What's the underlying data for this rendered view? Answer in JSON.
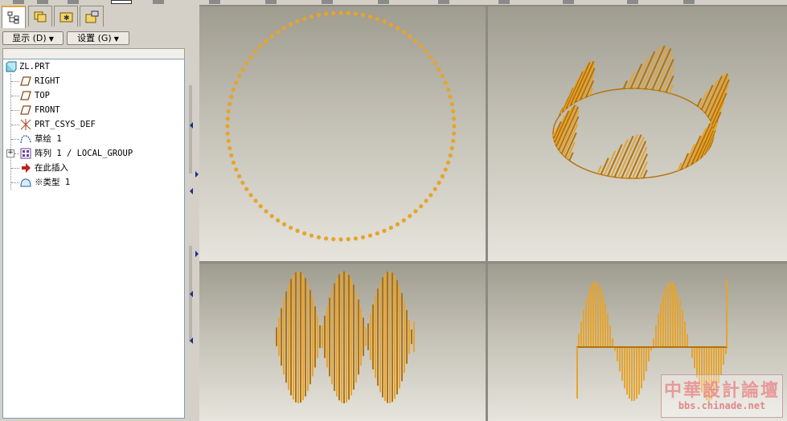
{
  "navigator": {
    "show_button": "显示 (D)",
    "settings_button": "设置 (G)"
  },
  "tree": [
    {
      "label": "ZL.PRT",
      "icon": "part-icon"
    },
    {
      "label": "RIGHT",
      "icon": "datum-plane-icon"
    },
    {
      "label": "TOP",
      "icon": "datum-plane-icon"
    },
    {
      "label": "FRONT",
      "icon": "datum-plane-icon"
    },
    {
      "label": "PRT_CSYS_DEF",
      "icon": "coordinate-system-icon"
    },
    {
      "label": "草绘 1",
      "icon": "sketch-icon"
    },
    {
      "label": "阵列 1 / LOCAL_GROUP",
      "icon": "pattern-icon"
    },
    {
      "label": "在此插入",
      "icon": "insert-here-arrow-icon"
    },
    {
      "label": "※类型 1",
      "icon": "feature-icon"
    }
  ],
  "colors": {
    "geometry": "#e6a42d",
    "geometry_dark": "#b4720a"
  },
  "watermark": {
    "title": "中華設計論壇",
    "url": "bbs.chinade.net"
  }
}
